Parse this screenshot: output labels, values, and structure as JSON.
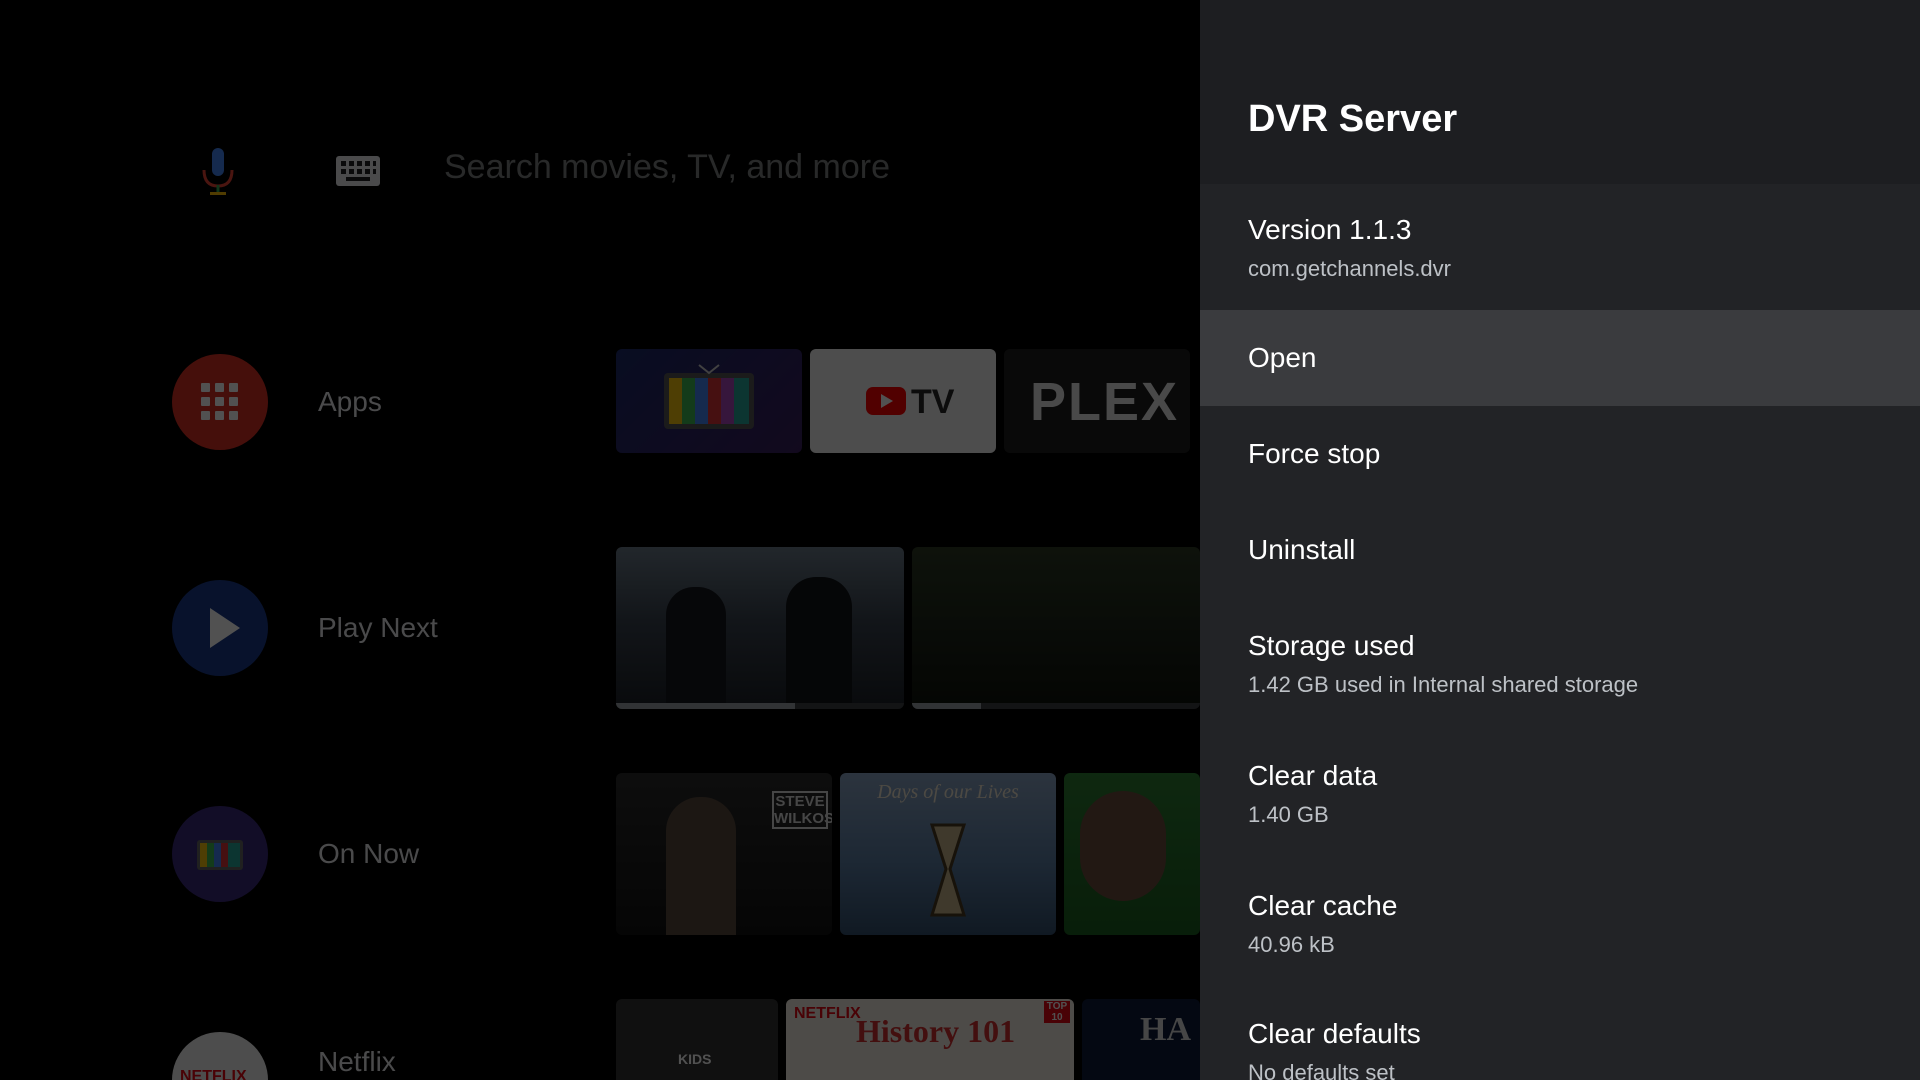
{
  "launcher": {
    "search_placeholder": "Search movies, TV, and more",
    "rows": [
      {
        "label": "Apps",
        "icon": "apps-grid-icon"
      },
      {
        "label": "Play Next",
        "icon": "play-icon"
      },
      {
        "label": "On Now",
        "icon": "tv-icon"
      },
      {
        "label": "Netflix",
        "icon": "netflix-icon"
      }
    ],
    "app_tiles": [
      {
        "name": "Live Channels",
        "icon": "tv-color-bars-icon"
      },
      {
        "name": "YouTube TV",
        "text": "TV"
      },
      {
        "name": "Plex",
        "text": "PLEX"
      }
    ],
    "play_next_progress": [
      0.62,
      0.24
    ],
    "on_now_tiles": [
      {
        "text": "STEVE WILKOS"
      },
      {
        "text": "Days of our Lives"
      },
      {
        "text": ""
      }
    ],
    "netflix_tiles": [
      {
        "text": "KIDS"
      },
      {
        "text": "NETFLIX",
        "title": "History 101",
        "badge": "TOP 10"
      },
      {
        "text": "HA"
      }
    ]
  },
  "panel": {
    "title": "DVR Server",
    "items": [
      {
        "label": "Version 1.1.3",
        "sub": "com.getchannels.dvr"
      },
      {
        "label": "Open",
        "sub": ""
      },
      {
        "label": "Force stop",
        "sub": ""
      },
      {
        "label": "Uninstall",
        "sub": ""
      },
      {
        "label": "Storage used",
        "sub": "1.42 GB used in Internal shared storage"
      },
      {
        "label": "Clear data",
        "sub": "1.40 GB"
      },
      {
        "label": "Clear cache",
        "sub": "40.96 kB"
      },
      {
        "label": "Clear defaults",
        "sub": "No defaults set"
      }
    ],
    "focused_index": 1
  },
  "colors": {
    "panel_bg": "#222326",
    "panel_header_bg": "#1d1e21",
    "focused_bg": "#3a3b3e",
    "apps_red": "#d93025",
    "play_blue": "#1a3a8a"
  }
}
